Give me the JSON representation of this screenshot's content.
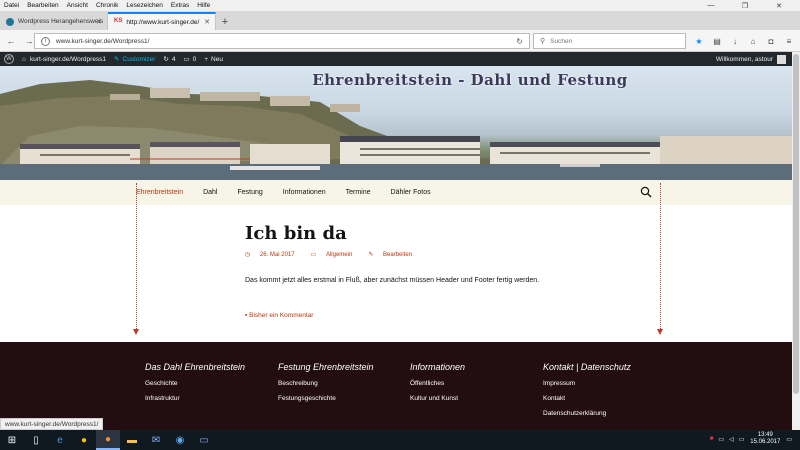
{
  "browser": {
    "menu": [
      "Datei",
      "Bearbeiten",
      "Ansicht",
      "Chronik",
      "Lesezeichen",
      "Extras",
      "Hilfe"
    ],
    "tabs": [
      {
        "label": "Wordpress Herangehensweis",
        "active": false
      },
      {
        "label": "http://www.kurt-singer.de/",
        "active": true
      }
    ],
    "url": "www.kurt-singer.de/Wordpress1/",
    "search_placeholder": "Suchen",
    "status_url": "www.kurt-singer.de/Wordpress1/"
  },
  "wpadmin": {
    "site": "kurt-singer.de/Wordpress1",
    "customizer": "Customizer",
    "updates": "4",
    "comments": "0",
    "new": "Neu",
    "welcome": "Willkommen, astour"
  },
  "site": {
    "title": "Ehrenbreitstein - Dahl und Festung",
    "nav": [
      "Ehrenbreitstein",
      "Dahl",
      "Festung",
      "Informationen",
      "Termine",
      "Dähler Fotos"
    ]
  },
  "post": {
    "title": "Ich bin da",
    "date": "26. Mai 2017",
    "category": "Allgemein",
    "edit": "Bearbeiten",
    "excerpt": "Das kommt jetzt alles erstmal in Fluß, aber zunächst müssen Header und Footer fertig werden.",
    "comments": "Bisher ein Kommentar"
  },
  "footer": {
    "columns": [
      {
        "title": "Das Dahl Ehrenbreitstein",
        "links": [
          "Geschichte",
          "Infrastruktur"
        ]
      },
      {
        "title": "Festung Ehrenbreitstein",
        "links": [
          "Beschreibung",
          "Festungsgeschichte"
        ]
      },
      {
        "title": "Informationen",
        "links": [
          "Öffentliches",
          "Kultur und Kunst"
        ]
      },
      {
        "title": "Kontakt | Datenschutz",
        "links": [
          "Impressum",
          "Kontakt",
          "Datenschutzerklärung"
        ]
      }
    ]
  },
  "taskbar": {
    "time": "13:49",
    "date": "15.06.2017"
  },
  "colors": {
    "accent": "#bc360a",
    "footer_bg": "#220e10",
    "nav_bg": "#f7f5e7",
    "wpbar_bg": "#23282d"
  }
}
